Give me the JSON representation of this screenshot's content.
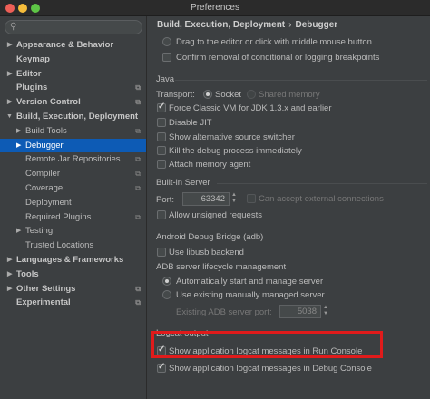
{
  "window": {
    "title": "Preferences"
  },
  "sidebar": {
    "search_placeholder": "",
    "items": [
      {
        "label": "Appearance & Behavior"
      },
      {
        "label": "Keymap"
      },
      {
        "label": "Editor"
      },
      {
        "label": "Plugins"
      },
      {
        "label": "Version Control"
      },
      {
        "label": "Build, Execution, Deployment"
      },
      {
        "label": "Build Tools"
      },
      {
        "label": "Debugger"
      },
      {
        "label": "Remote Jar Repositories"
      },
      {
        "label": "Compiler"
      },
      {
        "label": "Coverage"
      },
      {
        "label": "Deployment"
      },
      {
        "label": "Required Plugins"
      },
      {
        "label": "Testing"
      },
      {
        "label": "Trusted Locations"
      },
      {
        "label": "Languages & Frameworks"
      },
      {
        "label": "Tools"
      },
      {
        "label": "Other Settings"
      },
      {
        "label": "Experimental"
      }
    ]
  },
  "breadcrumb": {
    "parent": "Build, Execution, Deployment",
    "separator": "›",
    "current": "Debugger"
  },
  "top_options": {
    "drag_option": "Drag to the editor or click with middle mouse button",
    "confirm_removal": "Confirm removal of conditional or logging breakpoints"
  },
  "java": {
    "title": "Java",
    "transport_label": "Transport:",
    "socket": "Socket",
    "shared_memory": "Shared memory",
    "force_classic": "Force Classic VM for JDK 1.3.x and earlier",
    "disable_jit": "Disable JIT",
    "show_alt_source": "Show alternative source switcher",
    "kill_process": "Kill the debug process immediately",
    "attach_agent": "Attach memory agent"
  },
  "builtin_server": {
    "title": "Built-in Server",
    "port_label": "Port:",
    "port_value": "63342",
    "external_connections": "Can accept external connections",
    "unsigned_requests": "Allow unsigned requests"
  },
  "adb": {
    "title": "Android Debug Bridge (adb)",
    "use_libusb": "Use libusb backend",
    "lifecycle_title": "ADB server lifecycle management",
    "auto_start": "Automatically start and manage server",
    "use_existing": "Use existing manually managed server",
    "existing_port_label": "Existing ADB server port:",
    "existing_port_value": "5038"
  },
  "logcat": {
    "title": "Logcat output",
    "run_console": "Show application logcat messages in Run Console",
    "debug_console": "Show application logcat messages in Debug Console"
  },
  "colors": {
    "selection": "#0d5bb5",
    "highlight_box": "#e01b1b"
  }
}
